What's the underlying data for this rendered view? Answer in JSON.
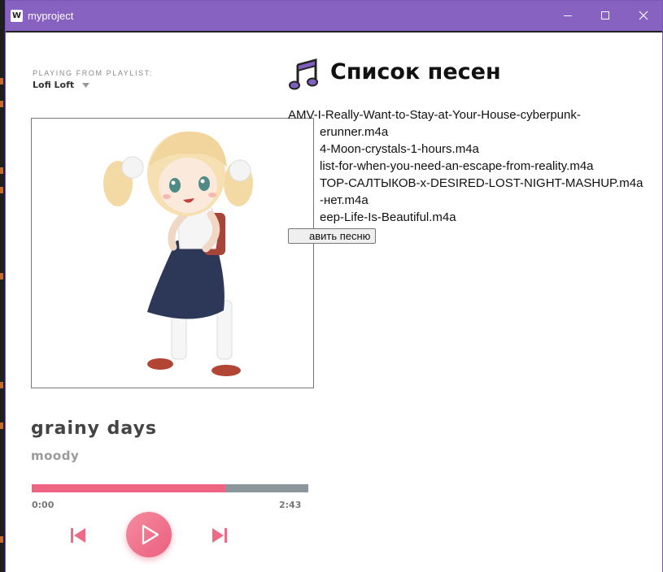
{
  "window": {
    "title": "myproject",
    "app_icon_letter": "W",
    "accent_color": "#8762c1"
  },
  "player": {
    "playlist_caption": "PLAYING FROM PLAYLIST:",
    "playlist_name": "Lofi Loft",
    "cover_icon": "anime-girl-illustration",
    "track_title": "grainy days",
    "track_artist": "moody",
    "progress_fraction": 0.7,
    "time_current": "0:00",
    "time_total": "2:43",
    "colors": {
      "accent": "#ed6583",
      "track_rest": "#8b979b"
    },
    "controls": {
      "prev_icon": "skip-previous-icon",
      "play_icon": "play-icon",
      "next_icon": "skip-next-icon"
    }
  },
  "songs": {
    "heading": "Список песен",
    "heading_icon": "music-note-icon",
    "items": [
      "AMV-I-Really-Want-to-Stay-at-Your-House-cyberpunk-",
      "erunner.m4a",
      "4-Moon-crystals-1-hours.m4a",
      "list-for-when-you-need-an-escape-from-reality.m4a",
      "ТОР-САЛТЫКОВ-x-DESIRED-LOST-NIGHT-MASHUP.m4a",
      "-нет.m4a",
      "eep-Life-Is-Beautiful.m4a"
    ],
    "add_button_label": "авить песню"
  }
}
